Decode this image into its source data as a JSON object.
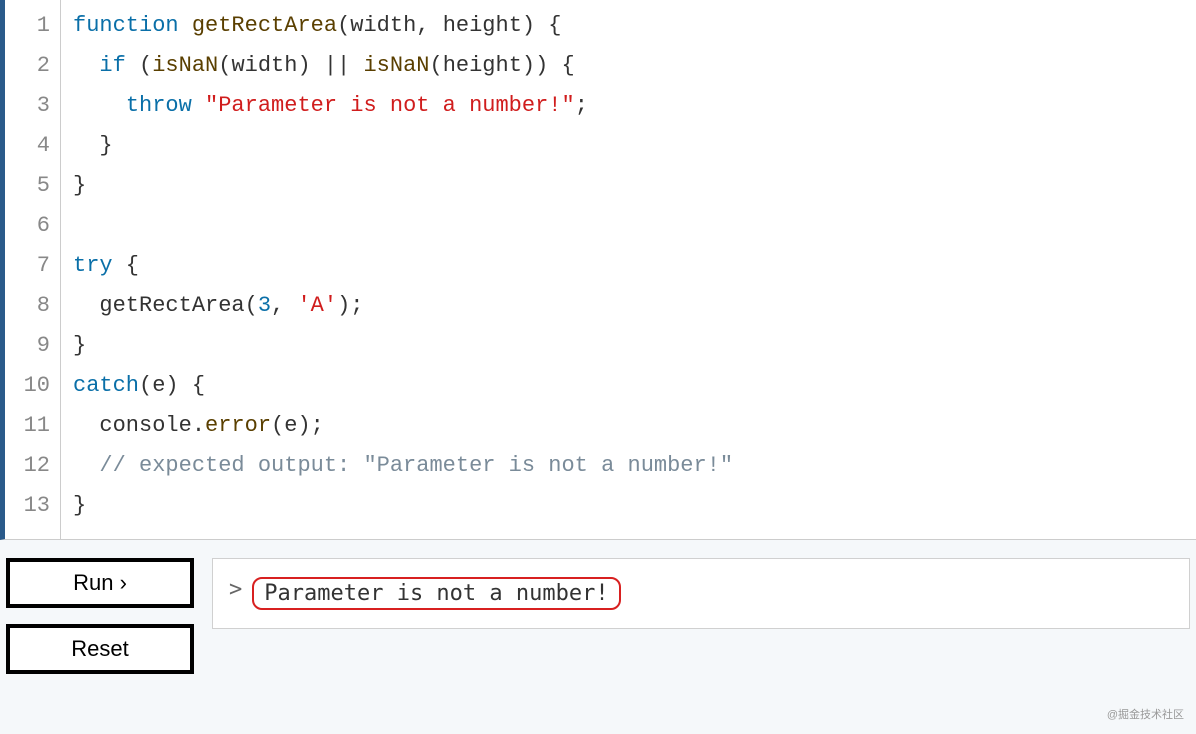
{
  "editor": {
    "line_numbers": [
      "1",
      "2",
      "3",
      "4",
      "5",
      "6",
      "7",
      "8",
      "9",
      "10",
      "11",
      "12",
      "13"
    ],
    "lines": [
      [
        {
          "t": "function ",
          "c": "tok-kw"
        },
        {
          "t": "getRectArea",
          "c": "tok-fn"
        },
        {
          "t": "(",
          "c": "tok-op"
        },
        {
          "t": "width",
          "c": "tok-ident"
        },
        {
          "t": ", ",
          "c": "tok-op"
        },
        {
          "t": "height",
          "c": "tok-ident"
        },
        {
          "t": ") {",
          "c": "tok-op"
        }
      ],
      [
        {
          "t": "  ",
          "c": ""
        },
        {
          "t": "if",
          "c": "tok-kw"
        },
        {
          "t": " (",
          "c": "tok-op"
        },
        {
          "t": "isNaN",
          "c": "tok-fn"
        },
        {
          "t": "(",
          "c": "tok-op"
        },
        {
          "t": "width",
          "c": "tok-ident"
        },
        {
          "t": ") || ",
          "c": "tok-op"
        },
        {
          "t": "isNaN",
          "c": "tok-fn"
        },
        {
          "t": "(",
          "c": "tok-op"
        },
        {
          "t": "height",
          "c": "tok-ident"
        },
        {
          "t": ")) {",
          "c": "tok-op"
        }
      ],
      [
        {
          "t": "    ",
          "c": ""
        },
        {
          "t": "throw",
          "c": "tok-kw"
        },
        {
          "t": " ",
          "c": ""
        },
        {
          "t": "\"Parameter is not a number!\"",
          "c": "tok-str"
        },
        {
          "t": ";",
          "c": "tok-op"
        }
      ],
      [
        {
          "t": "  }",
          "c": "tok-op"
        }
      ],
      [
        {
          "t": "}",
          "c": "tok-op"
        }
      ],
      [
        {
          "t": "",
          "c": ""
        }
      ],
      [
        {
          "t": "try",
          "c": "tok-kw"
        },
        {
          "t": " {",
          "c": "tok-op"
        }
      ],
      [
        {
          "t": "  getRectArea(",
          "c": "tok-ident"
        },
        {
          "t": "3",
          "c": "tok-num"
        },
        {
          "t": ", ",
          "c": "tok-op"
        },
        {
          "t": "'A'",
          "c": "tok-str"
        },
        {
          "t": ");",
          "c": "tok-op"
        }
      ],
      [
        {
          "t": "}",
          "c": "tok-op"
        }
      ],
      [
        {
          "t": "catch",
          "c": "tok-kw"
        },
        {
          "t": "(e) {",
          "c": "tok-op"
        }
      ],
      [
        {
          "t": "  console.",
          "c": "tok-ident"
        },
        {
          "t": "error",
          "c": "tok-fn"
        },
        {
          "t": "(e);",
          "c": "tok-op"
        }
      ],
      [
        {
          "t": "  ",
          "c": ""
        },
        {
          "t": "// expected output: \"Parameter is not a number!\"",
          "c": "tok-comment"
        }
      ],
      [
        {
          "t": "}",
          "c": "tok-op"
        }
      ]
    ]
  },
  "buttons": {
    "run": "Run ›",
    "reset": "Reset"
  },
  "output": {
    "caret": ">",
    "message": "Parameter is not a number!"
  },
  "watermark": "@掘金技术社区"
}
